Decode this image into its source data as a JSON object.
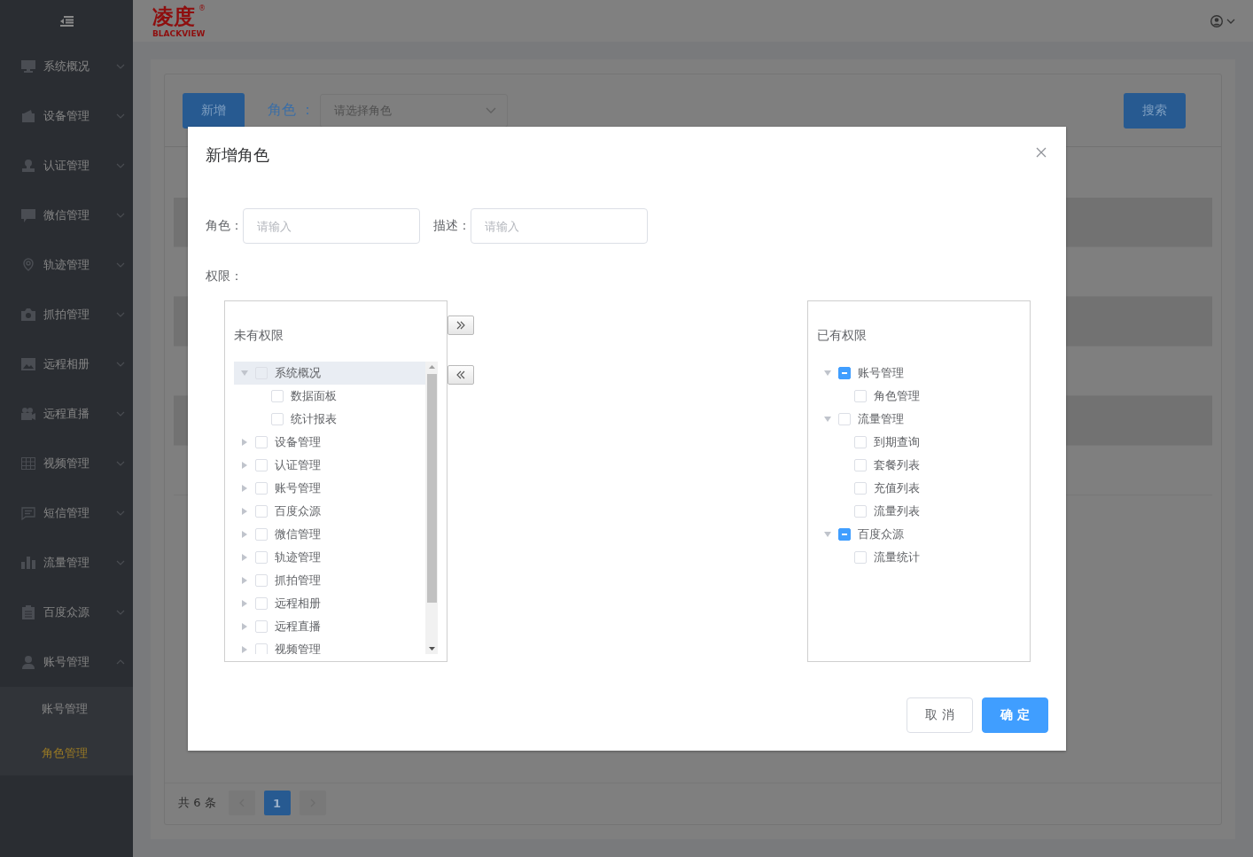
{
  "sidebar": {
    "items": [
      {
        "label": "系统概况",
        "expanded": false
      },
      {
        "label": "设备管理",
        "expanded": false
      },
      {
        "label": "认证管理",
        "expanded": false
      },
      {
        "label": "微信管理",
        "expanded": false
      },
      {
        "label": "轨迹管理",
        "expanded": false
      },
      {
        "label": "抓拍管理",
        "expanded": false
      },
      {
        "label": "远程相册",
        "expanded": false
      },
      {
        "label": "远程直播",
        "expanded": false
      },
      {
        "label": "视频管理",
        "expanded": false
      },
      {
        "label": "短信管理",
        "expanded": false
      },
      {
        "label": "流量管理",
        "expanded": false
      },
      {
        "label": "百度众源",
        "expanded": false
      },
      {
        "label": "账号管理",
        "expanded": true,
        "children": [
          {
            "label": "账号管理",
            "selected": false
          },
          {
            "label": "角色管理",
            "selected": true
          }
        ]
      }
    ]
  },
  "header": {
    "logo": {
      "name": "凌度",
      "mark": "®",
      "sub": "BLACKVIEW"
    }
  },
  "toolbar": {
    "add_button": "新增",
    "filter_label": "角色 ：",
    "select_placeholder": "请选择角色",
    "search_button": "搜索"
  },
  "table": {
    "rows": [
      {
        "striped": true
      },
      {
        "striped": false
      },
      {
        "striped": true
      },
      {
        "striped": false
      },
      {
        "striped": true
      },
      {
        "striped": false
      }
    ]
  },
  "pagination": {
    "total": "共 6 条",
    "pages": [
      {
        "label": "1",
        "selected": true
      }
    ]
  },
  "modal": {
    "title": "新增角色",
    "fields": [
      {
        "label": "角色：",
        "placeholder": "请输入"
      },
      {
        "label": "描述：",
        "placeholder": "请输入"
      }
    ],
    "permissions_label": "权限：",
    "transfer": {
      "left": {
        "title": "未有权限",
        "nodes": [
          {
            "label": "系统概况",
            "expanded": true,
            "selected": true,
            "indeterminate": false,
            "children": [
              {
                "label": "数据面板",
                "indeterminate": false
              },
              {
                "label": "统计报表",
                "indeterminate": false
              }
            ]
          },
          {
            "label": "设备管理",
            "expanded": false,
            "selected": false,
            "indeterminate": false
          },
          {
            "label": "认证管理",
            "expanded": false,
            "selected": false,
            "indeterminate": false
          },
          {
            "label": "账号管理",
            "expanded": false,
            "selected": false,
            "indeterminate": false
          },
          {
            "label": "百度众源",
            "expanded": false,
            "selected": false,
            "indeterminate": false
          },
          {
            "label": "微信管理",
            "expanded": false,
            "selected": false,
            "indeterminate": false
          },
          {
            "label": "轨迹管理",
            "expanded": false,
            "selected": false,
            "indeterminate": false
          },
          {
            "label": "抓拍管理",
            "expanded": false,
            "selected": false,
            "indeterminate": false
          },
          {
            "label": "远程相册",
            "expanded": false,
            "selected": false,
            "indeterminate": false
          },
          {
            "label": "远程直播",
            "expanded": false,
            "selected": false,
            "indeterminate": false
          },
          {
            "label": "视频管理",
            "expanded": false,
            "selected": false,
            "indeterminate": false
          }
        ]
      },
      "right": {
        "title": "已有权限",
        "nodes": [
          {
            "label": "账号管理",
            "expanded": true,
            "selected": false,
            "indeterminate": true,
            "children": [
              {
                "label": "角色管理",
                "indeterminate": false
              }
            ]
          },
          {
            "label": "流量管理",
            "expanded": true,
            "selected": false,
            "indeterminate": false,
            "children": [
              {
                "label": "到期查询",
                "indeterminate": false
              },
              {
                "label": "套餐列表",
                "indeterminate": false
              },
              {
                "label": "充值列表",
                "indeterminate": false
              },
              {
                "label": "流量列表",
                "indeterminate": false
              }
            ]
          },
          {
            "label": "百度众源",
            "expanded": true,
            "selected": false,
            "indeterminate": true,
            "children": [
              {
                "label": "流量统计",
                "indeterminate": false
              }
            ]
          }
        ]
      }
    },
    "buttons": [
      {
        "label": "取 消",
        "kind": "default"
      },
      {
        "label": "确 定",
        "kind": "primary"
      }
    ]
  }
}
